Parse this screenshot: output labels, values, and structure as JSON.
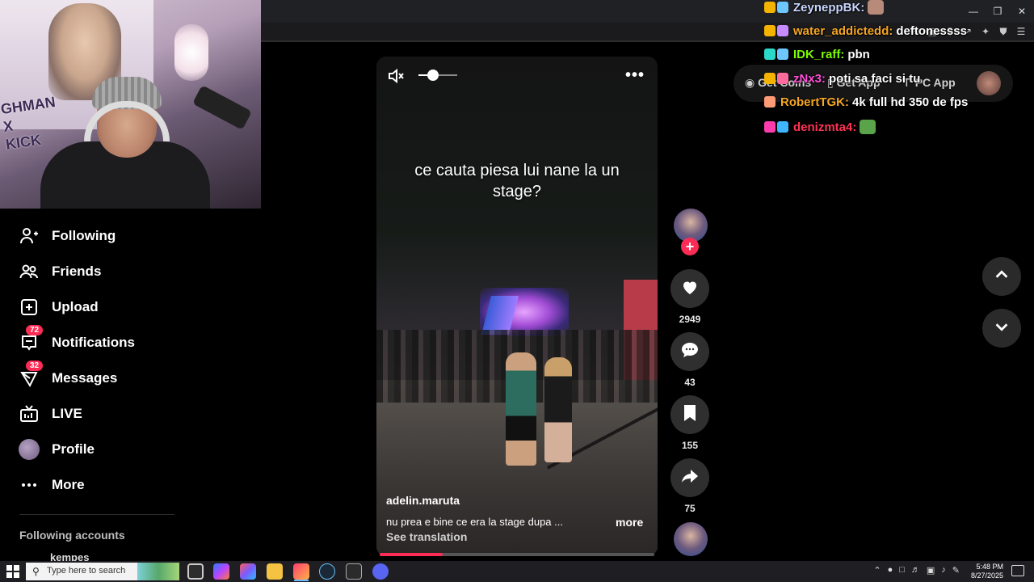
{
  "browser": {
    "toolbar_icons": [
      "split-icon",
      "screen-icon",
      "zoom-icon",
      "share-icon",
      "extensions-icon",
      "shield-icon",
      "menu-icon"
    ]
  },
  "webcam": {
    "poster_text": "GHMAN\nX\nKICK"
  },
  "sidebar": {
    "items": [
      {
        "label": "Following",
        "icon": "following-icon"
      },
      {
        "label": "Friends",
        "icon": "friends-icon"
      },
      {
        "label": "Upload",
        "icon": "upload-icon"
      },
      {
        "label": "Notifications",
        "icon": "notifications-icon",
        "badge": "72"
      },
      {
        "label": "Messages",
        "icon": "messages-icon",
        "badge": "32"
      },
      {
        "label": "LIVE",
        "icon": "live-icon"
      },
      {
        "label": "Profile",
        "icon": "profile-avatar"
      },
      {
        "label": "More",
        "icon": "more-icon"
      }
    ],
    "section_title": "Following accounts",
    "account_peek": "kempes"
  },
  "header": {
    "get_coins": "Get Coins",
    "get_app": "Get App",
    "pc_app": "PC App"
  },
  "video": {
    "caption": "ce cauta piesa lui nane la un stage?",
    "author": "adelin.maruta",
    "description": "nu prea e bine ce era la stage dupa ...",
    "more": "more",
    "see_translation": "See translation",
    "volume_level": 0.4,
    "progress": 0.23
  },
  "actions": {
    "likes": "2949",
    "comments": "43",
    "saves": "155",
    "shares": "75"
  },
  "chat": [
    {
      "name": "ZeyneppBK:",
      "name_color": "#c9d6ff",
      "msg": "",
      "badges": [
        "#f5b301",
        "#6ec6ff"
      ],
      "emote": "#b88a7a"
    },
    {
      "name": "water_addictedd:",
      "name_color": "#f5a623",
      "msg": "deftonessss",
      "badges": [
        "#f5b301",
        "#c78bff"
      ],
      "emote": ""
    },
    {
      "name": "IDK_raff:",
      "name_color": "#7CFC00",
      "msg": "pbn",
      "badges": [
        "#2bd9c9",
        "#6ec6ff"
      ],
      "emote": ""
    },
    {
      "name": "zNx3:",
      "name_color": "#ff4fd8",
      "msg": "poti sa faci si tu",
      "badges": [
        "#f5b301",
        "#ff6b9d"
      ],
      "emote": ""
    },
    {
      "name": "RobertTGK:",
      "name_color": "#f5a623",
      "msg": "4k full hd 350 de fps",
      "badges": [
        "#ff9a76"
      ],
      "emote": ""
    },
    {
      "name": "denizmta4:",
      "name_color": "#ff3355",
      "msg": "",
      "badges": [
        "#ff3cac",
        "#3fb6ff"
      ],
      "emote": "#5aa34a"
    }
  ],
  "taskbar": {
    "search_placeholder": "Type here to search",
    "time": "5:48 PM",
    "date": "8/27/2025",
    "apps": [
      "explorer-icon",
      "copilot-icon",
      "office-icon",
      "files-icon",
      "browser-icon",
      "steam-icon",
      "xbox-icon",
      "discord-icon"
    ]
  },
  "colors": {
    "accent": "#fe2c55",
    "panel": "#2f2f2f"
  }
}
